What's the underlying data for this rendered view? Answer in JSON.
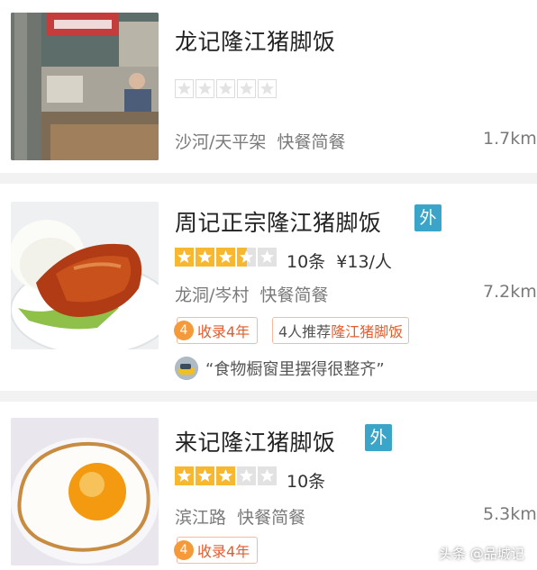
{
  "restaurants": [
    {
      "name": "龙记隆江猪脚饭",
      "rating_stars": 0,
      "area": "沙河/天平架",
      "category": "快餐简餐",
      "distance": "1.7km"
    },
    {
      "name": "周记正宗隆江猪脚饭",
      "takeout_tag": "外",
      "rating_stars": 3.5,
      "reviews": "10条",
      "price": "¥13/人",
      "area": "龙洞/岑村",
      "category": "快餐简餐",
      "distance": "7.2km",
      "badge_num": "4",
      "badge_text": "收录4年",
      "recommend_prefix": "4人推荐",
      "recommend_dish": "隆江猪脚饭",
      "review_quote": "“食物橱窗里摆得很整齐”"
    },
    {
      "name": "来记隆江猪脚饭",
      "takeout_tag": "外",
      "rating_stars": 3,
      "reviews": "10条",
      "area": "滨江路",
      "category": "快餐简餐",
      "distance": "5.3km",
      "badge_num": "4",
      "badge_text": "收录4年"
    }
  ],
  "watermark": "头条 @品城记",
  "colors": {
    "star_filled": "#f7b72e",
    "star_empty": "#e2e2e2",
    "takeout_tag": "#3aa5c8",
    "badge_accent": "#e85a2a"
  }
}
